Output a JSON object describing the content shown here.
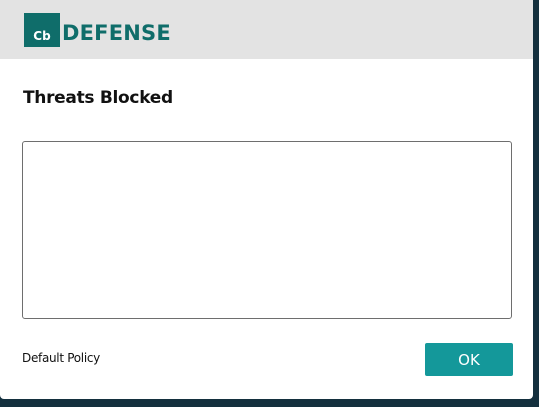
{
  "header": {
    "logo_mark": "Cb",
    "logo_word": "DEFENSE"
  },
  "dialog": {
    "title": "Threats Blocked",
    "threats_list": "",
    "policy_name": "Default Policy",
    "ok_label": "OK"
  },
  "colors": {
    "brand": "#0f6d6a",
    "button": "#14989a",
    "header_bg": "#e3e3e3",
    "backdrop": "#14303e"
  }
}
